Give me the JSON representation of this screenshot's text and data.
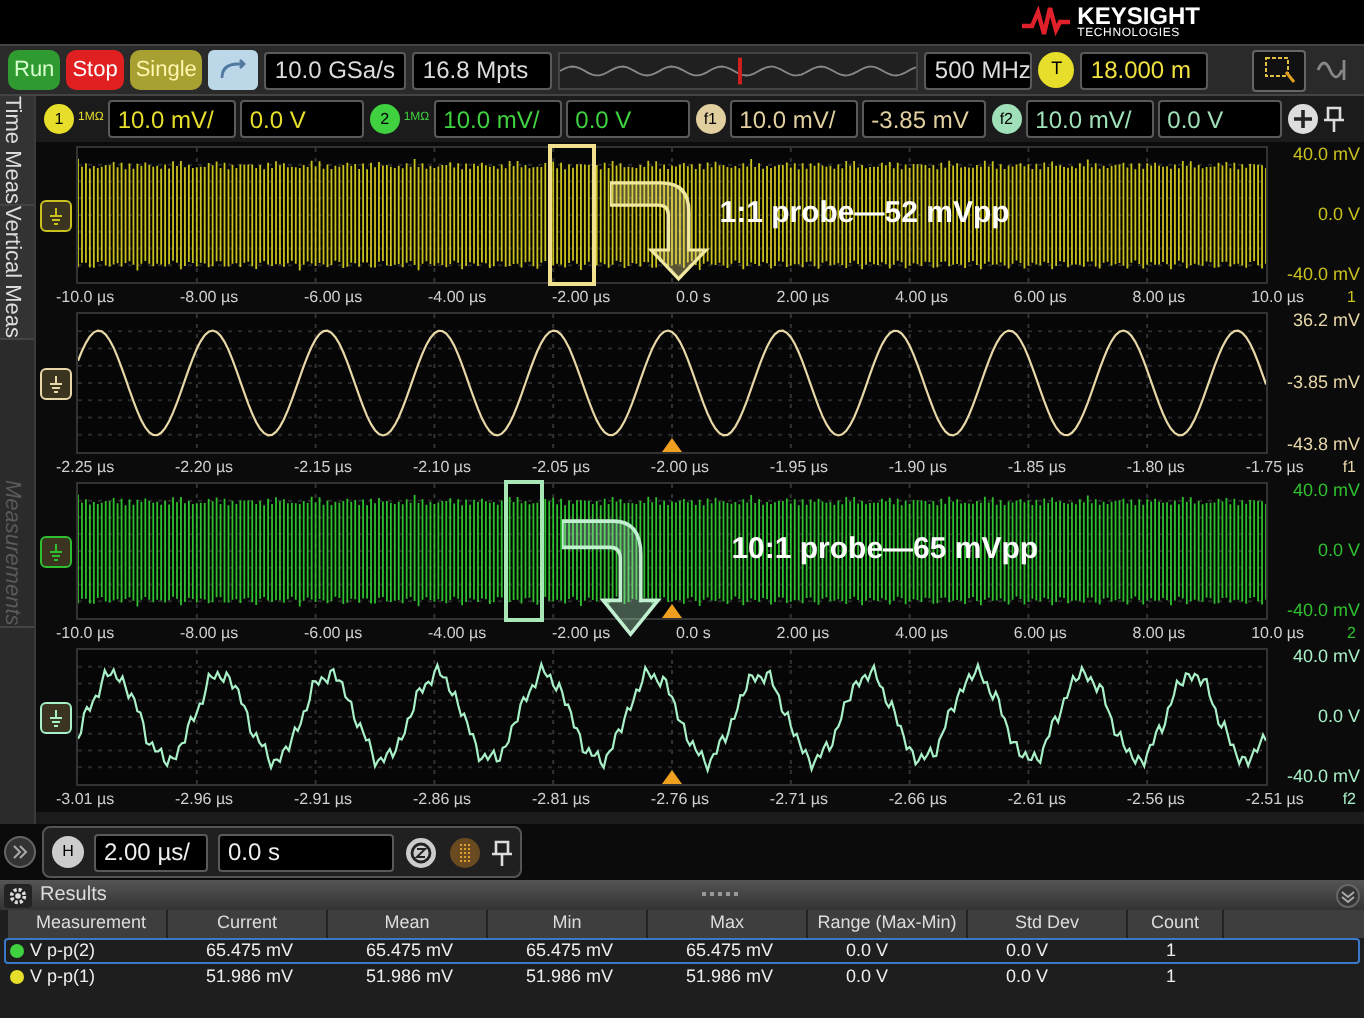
{
  "logo": {
    "name": "KEYSIGHT",
    "sub": "TECHNOLOGIES"
  },
  "acquisition": {
    "buttons": [
      {
        "label": "Run",
        "kind": "run"
      },
      {
        "label": "Stop",
        "kind": "stop"
      },
      {
        "label": "Single",
        "kind": "single"
      }
    ],
    "sample_rate": "10.0 GSa/s",
    "memory": "16.8 Mpts",
    "bandwidth": "500 MHz",
    "trigger_badge": "T",
    "trigger_level": "18.000 m"
  },
  "channels": [
    {
      "badge": "1",
      "impedance": "1MΩ",
      "scale": "10.0 mV/",
      "offset": "0.0 V",
      "color": "#e6de2a"
    },
    {
      "badge": "2",
      "impedance": "1MΩ",
      "scale": "10.0 mV/",
      "offset": "0.0 V",
      "color": "#3fd13f"
    },
    {
      "badge": "f1",
      "scale": "10.0 mV/",
      "offset": "-3.85 mV",
      "color": "#e2cfa0"
    },
    {
      "badge": "f2",
      "scale": "10.0 mV/",
      "offset": "0.0 V",
      "color": "#9fe0b8"
    }
  ],
  "side_tabs": [
    {
      "label": "Time Meas",
      "disabled": false
    },
    {
      "label": "Vertical Meas",
      "disabled": false
    },
    {
      "label": "Measurements",
      "disabled": true
    }
  ],
  "panels": [
    {
      "kind": "dense",
      "color": "#c9c21e",
      "y_labels": [
        "40.0 mV",
        "0.0 V",
        "-40.0 mV"
      ],
      "x_labels": [
        "-10.0 µs",
        "-8.00 µs",
        "-6.00 µs",
        "-4.00 µs",
        "-2.00 µs",
        "0.0 s",
        "2.00 µs",
        "4.00 µs",
        "6.00 µs",
        "8.00 µs",
        "10.0 µs"
      ],
      "source": "1",
      "annotation": "1:1 probe—52 mVpp"
    },
    {
      "kind": "sine",
      "color": "#e8d8a8",
      "y_labels": [
        "36.2 mV",
        "-3.85 mV",
        "-43.8 mV"
      ],
      "x_labels": [
        "-2.25 µs",
        "-2.20 µs",
        "-2.15 µs",
        "-2.10 µs",
        "-2.05 µs",
        "-2.00 µs",
        "-1.95 µs",
        "-1.90 µs",
        "-1.85 µs",
        "-1.80 µs",
        "-1.75 µs"
      ],
      "source": "f1"
    },
    {
      "kind": "dense",
      "color": "#2fc02f",
      "y_labels": [
        "40.0 mV",
        "0.0 V",
        "-40.0 mV"
      ],
      "x_labels": [
        "-10.0 µs",
        "-8.00 µs",
        "-6.00 µs",
        "-4.00 µs",
        "-2.00 µs",
        "0.0 s",
        "2.00 µs",
        "4.00 µs",
        "6.00 µs",
        "8.00 µs",
        "10.0 µs"
      ],
      "source": "2",
      "annotation": "10:1 probe—65 mVpp"
    },
    {
      "kind": "noisy",
      "color": "#a8f0c8",
      "y_labels": [
        "40.0 mV",
        "0.0 V",
        "-40.0 mV"
      ],
      "x_labels": [
        "-3.01 µs",
        "-2.96 µs",
        "-2.91 µs",
        "-2.86 µs",
        "-2.81 µs",
        "-2.76 µs",
        "-2.71 µs",
        "-2.66 µs",
        "-2.61 µs",
        "-2.56 µs",
        "-2.51 µs"
      ],
      "source": "f2"
    }
  ],
  "horizontal": {
    "badge": "H",
    "scale": "2.00 µs/",
    "position": "0.0 s"
  },
  "results": {
    "title": "Results",
    "columns": [
      "Measurement",
      "Current",
      "Mean",
      "Min",
      "Max",
      "Range (Max-Min)",
      "Std Dev",
      "Count"
    ],
    "rows": [
      {
        "color": "#3fd13f",
        "selected": true,
        "cells": [
          "V p-p(2)",
          "65.475 mV",
          "65.475 mV",
          "65.475 mV",
          "65.475 mV",
          "0.0 V",
          "0.0 V",
          "1"
        ]
      },
      {
        "color": "#e6de2a",
        "selected": false,
        "cells": [
          "V p-p(1)",
          "51.986 mV",
          "51.986 mV",
          "51.986 mV",
          "51.986 mV",
          "0.0 V",
          "0.0 V",
          "1"
        ]
      }
    ]
  }
}
